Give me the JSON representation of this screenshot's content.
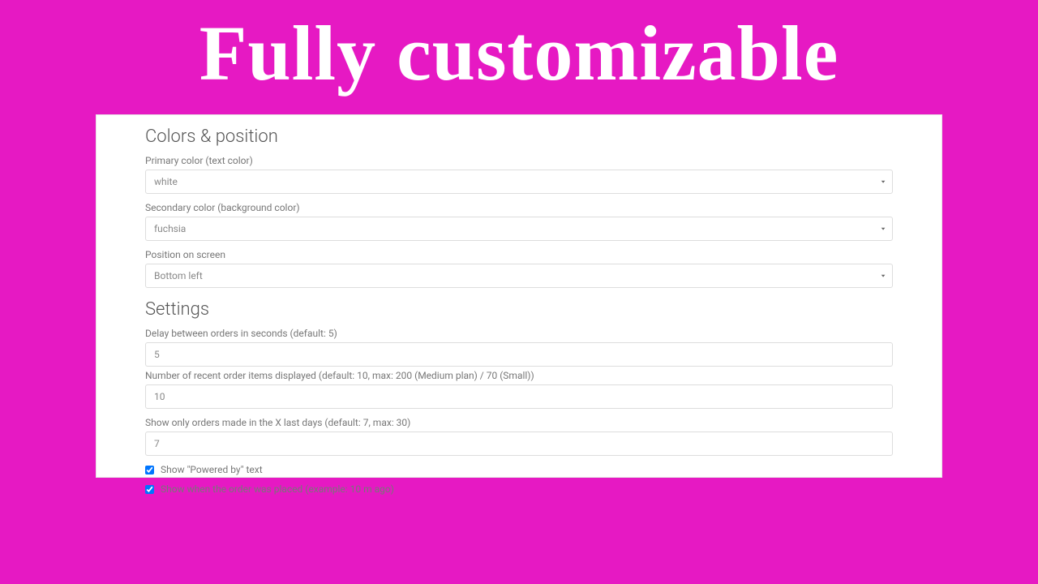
{
  "hero": {
    "title": "Fully customizable"
  },
  "sections": {
    "colors": {
      "title": "Colors & position",
      "primary": {
        "label": "Primary color (text color)",
        "value": "white"
      },
      "secondary": {
        "label": "Secondary color (background color)",
        "value": "fuchsia"
      },
      "position": {
        "label": "Position on screen",
        "value": "Bottom left"
      }
    },
    "settings": {
      "title": "Settings",
      "delay": {
        "label": "Delay between orders in seconds (default: 5)",
        "value": "5"
      },
      "items": {
        "label": "Number of recent order items displayed (default: 10, max: 200 (Medium plan) / 70 (Small))",
        "value": "10"
      },
      "days": {
        "label": "Show only orders made in the X last days (default: 7, max: 30)",
        "value": "7"
      },
      "powered": {
        "label": "Show \"Powered by\" text",
        "checked": true
      },
      "when": {
        "label": "Show when the order was placed (example: 10 m ago)",
        "checked": true
      }
    }
  }
}
